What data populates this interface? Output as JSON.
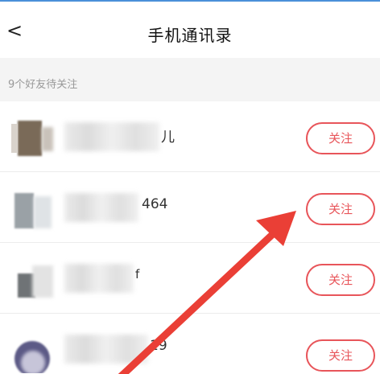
{
  "header": {
    "back_icon": "chevron-left-icon",
    "back_glyph": "<",
    "title": "手机通讯录"
  },
  "section": {
    "label": "9个好友待关注"
  },
  "contacts": [
    {
      "name_visible": "儿",
      "button_label": "关注"
    },
    {
      "name_visible": "464",
      "button_label": "关注"
    },
    {
      "name_visible": "f",
      "button_label": "关注"
    },
    {
      "name_visible": "19",
      "button_label": "关注"
    }
  ],
  "colors": {
    "accent": "#e8555a",
    "arrow": "#ea3f36",
    "section_bg": "#f4f4f4"
  }
}
